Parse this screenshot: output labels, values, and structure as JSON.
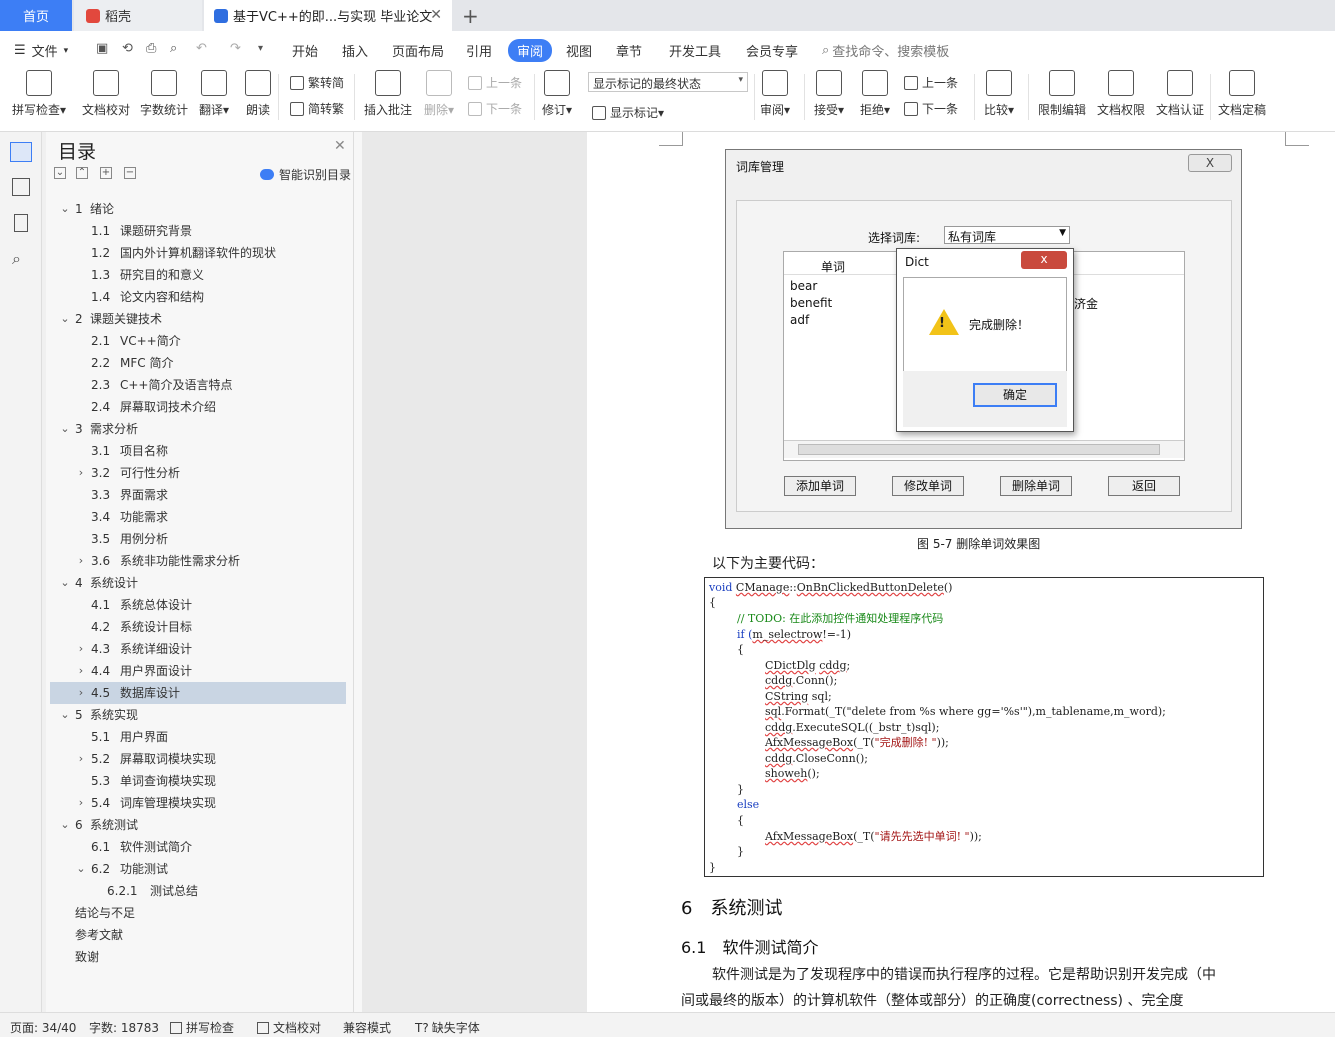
{
  "tabs": {
    "home": "首页",
    "daoke": "稻壳",
    "doc": "基于VC++的即...与实现 毕业论文"
  },
  "menu": {
    "file": "文件",
    "items": [
      "开始",
      "插入",
      "页面布局",
      "引用",
      "审阅",
      "视图",
      "章节",
      "开发工具",
      "会员专享"
    ],
    "search": "查找命令、搜索模板"
  },
  "toolbar": {
    "spell": "拼写检查",
    "proof": "文档校对",
    "wordcount": "字数统计",
    "translate": "翻译",
    "read": "朗读",
    "trad": "繁转简",
    "simp": "简转繁",
    "insert_comment": "插入批注",
    "delete": "删除",
    "prev": "上一条",
    "next": "下一条",
    "revise": "修订",
    "markup_state": "显示标记的最终状态",
    "show_markup": "显示标记",
    "review": "审阅",
    "accept": "接受",
    "reject": "拒绝",
    "prev2": "上一条",
    "next2": "下一条",
    "compare": "比较",
    "restrict": "限制编辑",
    "doc_rights": "文档权限",
    "doc_auth": "文档认证",
    "doc_final": "文档定稿"
  },
  "toc": {
    "title": "目录",
    "smart": "智能识别目录",
    "items": [
      {
        "num": "1",
        "text": "绪论"
      },
      {
        "num": "1.1",
        "text": "课题研究背景"
      },
      {
        "num": "1.2",
        "text": "国内外计算机翻译软件的现状"
      },
      {
        "num": "1.3",
        "text": "研究目的和意义"
      },
      {
        "num": "1.4",
        "text": "论文内容和结构"
      },
      {
        "num": "2",
        "text": "课题关键技术"
      },
      {
        "num": "2.1",
        "text": "VC++简介"
      },
      {
        "num": "2.2",
        "text": "MFC 简介"
      },
      {
        "num": "2.3",
        "text": "C++简介及语言特点"
      },
      {
        "num": "2.4",
        "text": "屏幕取词技术介绍"
      },
      {
        "num": "3",
        "text": "需求分析"
      },
      {
        "num": "3.1",
        "text": "项目名称"
      },
      {
        "num": "3.2",
        "text": "可行性分析"
      },
      {
        "num": "3.3",
        "text": "界面需求"
      },
      {
        "num": "3.4",
        "text": "功能需求"
      },
      {
        "num": "3.5",
        "text": "用例分析"
      },
      {
        "num": "3.6",
        "text": "系统非功能性需求分析"
      },
      {
        "num": "4",
        "text": "系统设计"
      },
      {
        "num": "4.1",
        "text": "系统总体设计"
      },
      {
        "num": "4.2",
        "text": "系统设计目标"
      },
      {
        "num": "4.3",
        "text": "系统详细设计"
      },
      {
        "num": "4.4",
        "text": "用户界面设计"
      },
      {
        "num": "4.5",
        "text": "数据库设计"
      },
      {
        "num": "5",
        "text": "系统实现"
      },
      {
        "num": "5.1",
        "text": "用户界面"
      },
      {
        "num": "5.2",
        "text": "屏幕取词模块实现"
      },
      {
        "num": "5.3",
        "text": "单词查询模块实现"
      },
      {
        "num": "5.4",
        "text": "词库管理模块实现"
      },
      {
        "num": "6",
        "text": "系统测试"
      },
      {
        "num": "6.1",
        "text": "软件测试简介"
      },
      {
        "num": "6.2",
        "text": "功能测试"
      },
      {
        "num": "6.2.1",
        "text": "测试总结"
      },
      {
        "num": "",
        "text": "结论与不足"
      },
      {
        "num": "",
        "text": "参考文献"
      },
      {
        "num": "",
        "text": "致谢"
      }
    ]
  },
  "figure": {
    "title": "词库管理",
    "close": "X",
    "select_label": "选择词库:",
    "select_value": "私有词库",
    "col_word": "单词",
    "words": [
      "bear",
      "benefit",
      "adf"
    ],
    "extra": "济金",
    "buttons": [
      "添加单词",
      "修改单词",
      "删除单词",
      "返回"
    ],
    "dialog_title": "Dict",
    "dialog_close": "x",
    "dialog_msg": "完成删除！",
    "dialog_ok": "确定"
  },
  "caption": "图 5-7 删除单词效果图",
  "code_intro": "以下为主要代码：",
  "code": {
    "l1a": "void ",
    "l1b": "CManage",
    "l1c": "::",
    "l1d": "OnBnClickedButtonDelete",
    "l1e": "()",
    "l2": "{",
    "l3": "// TODO: 在此添加控件通知处理程序代码",
    "l4a": "if (",
    "l4b": "m_selectrow",
    "l4c": "!=-1)",
    "l5": "{",
    "l6a": "CDictDlg",
    "l6b": " ",
    "l6c": "cddg",
    "l6d": ";",
    "l7a": "cddg",
    ".l7b": "",
    "l7c": ".Conn();",
    "l8a": "CString",
    " l8b": "",
    "l8c": " sql",
    "l8d": ";",
    "l9a": "sql",
    ".l9b": "",
    "l9c": ".Format(_T(\"delete from %s where gg='%s'\"),m_tablename,m_word);",
    "l10a": "cddg",
    "l10c": ".ExecuteSQL((_bstr_t)sql);",
    "l11a": "AfxMessageBox",
    "l11b": "(_T(",
    "l11c": "\"完成删除! \"",
    "l11d": "));",
    "l12a": "cddg",
    "l12c": ".CloseConn();",
    "l13a": "showeh",
    "l13c": "();",
    "l14": "}",
    "l15": "else",
    "l16": "{",
    "l17a": "AfxMessageBox",
    "l17b": "(_T(",
    "l17c": "\"请先先选中单词! \"",
    "l17d": "));",
    "l18": "}",
    "l19": "}"
  },
  "heading6": "6　系统测试",
  "heading61": "6.1　软件测试简介",
  "para1": "软件测试是为了发现程序中的错误而执行程序的过程。它是帮助识别开发完成（中",
  "para2": "间或最终的版本）的计算机软件（整体或部分）的正确度(correctness) 、完全度",
  "status": {
    "page": "页面: 34/40",
    "words": "字数: 18783",
    "spell": "拼写检查",
    "proof": "文档校对",
    "compat": "兼容模式",
    "missing_font": "缺失字体"
  },
  "colors": {
    "accent": "#3d7ef5",
    "selected_toc": "#c9d5e3"
  }
}
